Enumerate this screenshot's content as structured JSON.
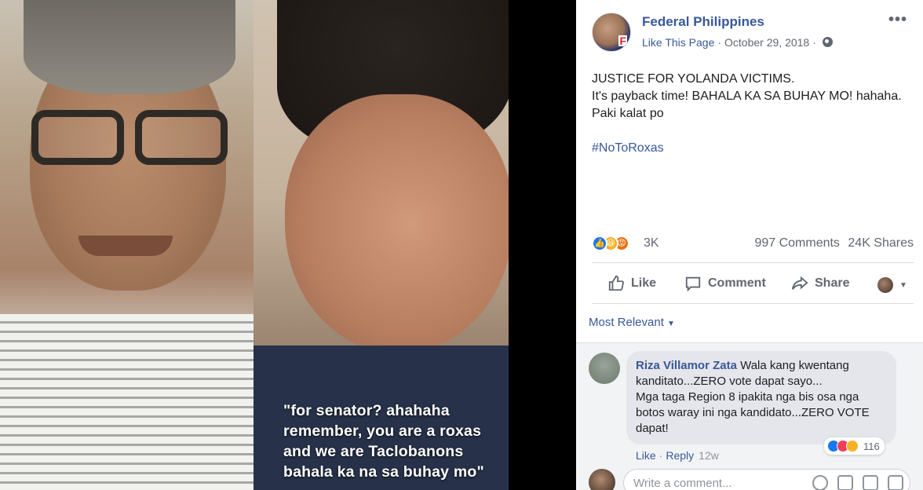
{
  "media": {
    "caption": "\"for senator? ahahaha remember, you are a roxas and we are Taclobanons bahala ka na sa buhay mo\""
  },
  "post": {
    "page_name": "Federal Philippines",
    "like_page": "Like This Page",
    "date": "October 29, 2018",
    "more": "•••",
    "text": "JUSTICE FOR YOLANDA VICTIMS.\nIt's payback time! BAHALA KA SA BUHAY MO! hahaha. Paki kalat po",
    "hashtag": "#NoToRoxas",
    "reaction_count": "3K",
    "comments_count": "997 Comments",
    "shares_count": "24K Shares"
  },
  "actions": {
    "like": "Like",
    "comment": "Comment",
    "share": "Share"
  },
  "comments": {
    "sort": "Most Relevant",
    "items": [
      {
        "author": "Riza Villamor Zata",
        "text": "Wala kang kwentang kanditato...ZERO vote dapat sayo...\nMga taga Region 8 ipakita nga bis osa nga botos waray ini nga kandidato...ZERO VOTE dapat!",
        "reactions": "116",
        "like": "Like",
        "reply": "Reply",
        "time": "12w"
      }
    ],
    "write_placeholder": "Write a comment..."
  },
  "colors": {
    "link": "#385898",
    "muted": "#606770",
    "like_blue": "#1877f2"
  }
}
